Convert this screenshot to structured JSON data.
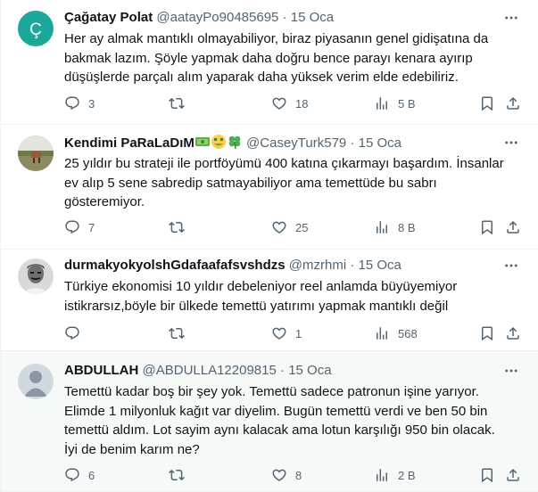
{
  "tweets": [
    {
      "name": "Çağatay Polat",
      "handle": "@aatayPo90485695",
      "date": "15 Oca",
      "avatar_letter": "Ç",
      "avatar_color": "#1aa89a",
      "lines": [
        "Her ay almak mantıklı olmayabiliyor, biraz piyasanın genel gidişatına da",
        "bakmak lazım. Şöyle yapmak daha doğru bence parayı kenara ayırıp",
        "düşüşlerde parçalı alım yaparak daha yüksek verim elde edebiliriz."
      ],
      "replies": "3",
      "retweets": "",
      "likes": "18",
      "views": "5 B"
    },
    {
      "name": "Kendimi PaRaLaDıM",
      "name_emojis": [
        "money-bill-emoji",
        "money-mouth-face-emoji",
        "four-leaf-clover-emoji"
      ],
      "handle": "@CaseyTurk579",
      "date": "15 Oca",
      "lines": [
        "25 yıldır bu strateji ile portföyümü 400 katına çıkarmayı başardım. İnsanlar",
        "ev alıp 5 sene sabredip satmayabiliyor ama temettüde bu sabrı",
        "gösteremiyor."
      ],
      "replies": "7",
      "retweets": "",
      "likes": "25",
      "views": "8 B"
    },
    {
      "name": "durmakyokyolshGdafaafafsvshdzs",
      "handle": "@mzrhmi",
      "date": "15 Oca",
      "lines": [
        "Türkiye ekonomisi 10 yıldır debeleniyor reel anlamda büyüyemiyor",
        "istikrarsız,böyle bir ülkede temettü yatırımı yapmak mantıklı değil"
      ],
      "replies": "",
      "retweets": "",
      "likes": "1",
      "views": "568"
    },
    {
      "name": "ABDULLAH",
      "handle": "@ABDULLA12209815",
      "date": "15 Oca",
      "lines": [
        "Temettü kadar boş bir şey yok. Temettü sadece patronun işine yarıyor.",
        "Elimde 1 milyonluk kağıt var diyelim. Bugün temettü verdi ve ben 50 bin",
        "temettü aldım. Lot sayim aynı kalacak ama lotun karşılığı 950 bin olacak.",
        "İyi de benim karım ne?"
      ],
      "replies": "6",
      "retweets": "",
      "likes": "8",
      "views": "2 B"
    }
  ],
  "dot": "·",
  "colors": {
    "text": "#0f1419",
    "secondary": "#536471",
    "border": "#eff3f4",
    "highlight": "#f7f9f9"
  }
}
